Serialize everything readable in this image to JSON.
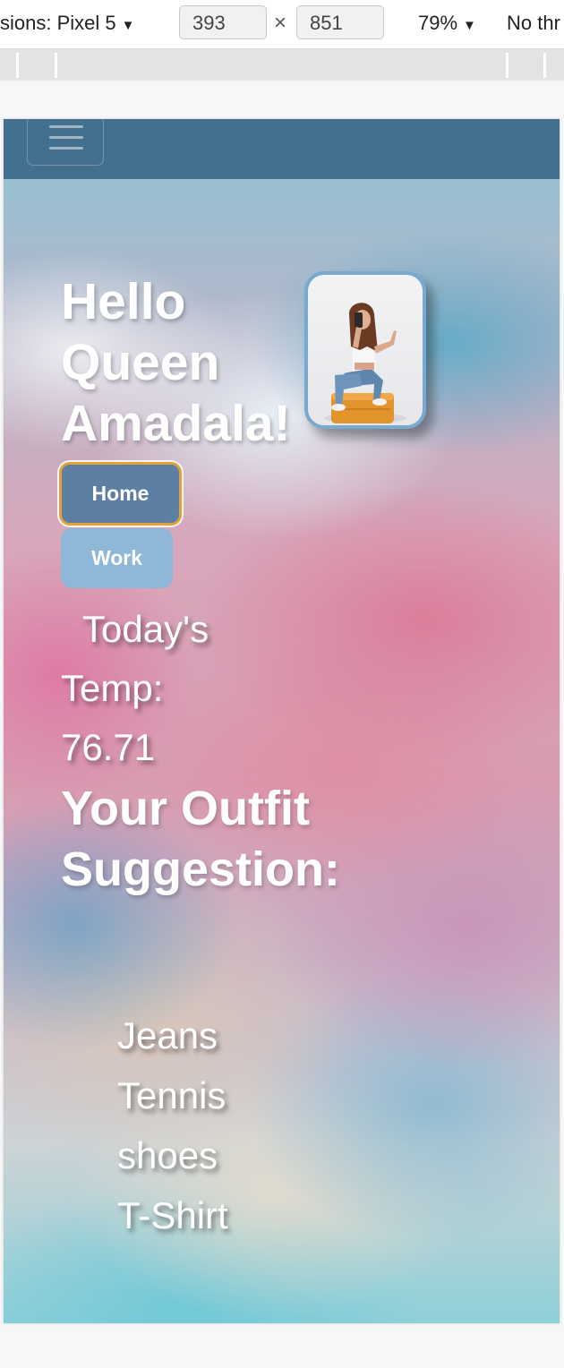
{
  "devtools": {
    "dimensions_label": "sions: Pixel 5",
    "width_value": "393",
    "height_value": "851",
    "times_symbol": "×",
    "zoom_label": "79%",
    "throttle_label": "No thr"
  },
  "page": {
    "heading": "Hello Queen Amadala!",
    "nav": {
      "home_label": "Home",
      "work_label": "Work"
    },
    "temperature": {
      "label_line1": "Today's",
      "label_line2": "Temp:",
      "value": "76.71"
    },
    "suggestion_title": "Your Outfit Suggestion:",
    "outfit_items": [
      "Jeans",
      "Tennis shoes",
      "T-Shirt"
    ]
  },
  "colors": {
    "navbar": "#44708f",
    "home_button": "#5d7fa3",
    "home_button_border": "#e0a23a",
    "work_button": "#8fb7d7",
    "avatar_border": "#79a9cf"
  },
  "icons": {
    "menu": "hamburger-icon",
    "dropdown": "caret-down-icon"
  }
}
